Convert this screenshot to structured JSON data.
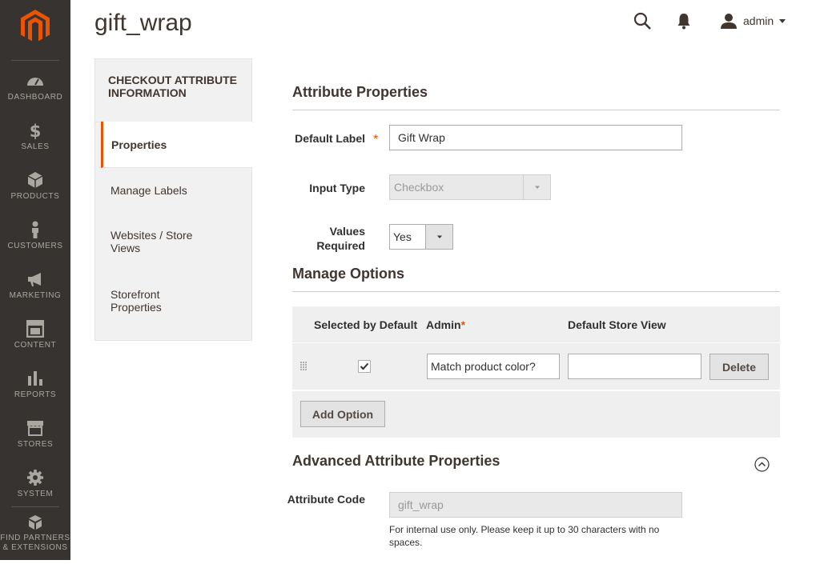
{
  "sidebar": {
    "items": [
      {
        "label": "DASHBOARD",
        "icon": "dashboard-icon"
      },
      {
        "label": "SALES",
        "icon": "dollar-icon"
      },
      {
        "label": "PRODUCTS",
        "icon": "box-icon"
      },
      {
        "label": "CUSTOMERS",
        "icon": "person-icon"
      },
      {
        "label": "MARKETING",
        "icon": "megaphone-icon"
      },
      {
        "label": "CONTENT",
        "icon": "layout-icon"
      },
      {
        "label": "REPORTS",
        "icon": "bar-chart-icon"
      },
      {
        "label": "STORES",
        "icon": "storefront-icon"
      },
      {
        "label": "SYSTEM",
        "icon": "gear-icon"
      },
      {
        "label": "FIND PARTNERS",
        "label2": "& EXTENSIONS",
        "icon": "cubes-icon"
      }
    ]
  },
  "header": {
    "title": "gift_wrap",
    "user": "admin"
  },
  "tabs": {
    "heading": "CHECKOUT ATTRIBUTE INFORMATION",
    "items": [
      {
        "label": "Properties"
      },
      {
        "label": "Manage Labels"
      },
      {
        "label": "Websites / Store Views"
      },
      {
        "label": "Storefront Properties"
      }
    ]
  },
  "attribute_properties": {
    "title": "Attribute Properties",
    "default_label": {
      "label": "Default Label",
      "required_mark": "*",
      "value": "Gift Wrap"
    },
    "input_type": {
      "label": "Input Type",
      "value": "Checkbox"
    },
    "values_required": {
      "label": "Values Required",
      "value": "Yes"
    }
  },
  "manage_options": {
    "title": "Manage Options",
    "columns": {
      "selected": "Selected by Default",
      "admin": "Admin",
      "admin_req": "*",
      "store_view": "Default Store View"
    },
    "rows": [
      {
        "checked": true,
        "admin_value": "Match product color?",
        "store_view_value": "",
        "delete_label": "Delete"
      }
    ],
    "add_option_label": "Add Option"
  },
  "advanced": {
    "title": "Advanced Attribute Properties",
    "attribute_code": {
      "label": "Attribute Code",
      "value": "gift_wrap"
    },
    "note": "For internal use only. Please keep it up to 30 characters with no spaces."
  },
  "colors": {
    "accent": "#eb5202",
    "sidebar_bg": "#373330"
  }
}
